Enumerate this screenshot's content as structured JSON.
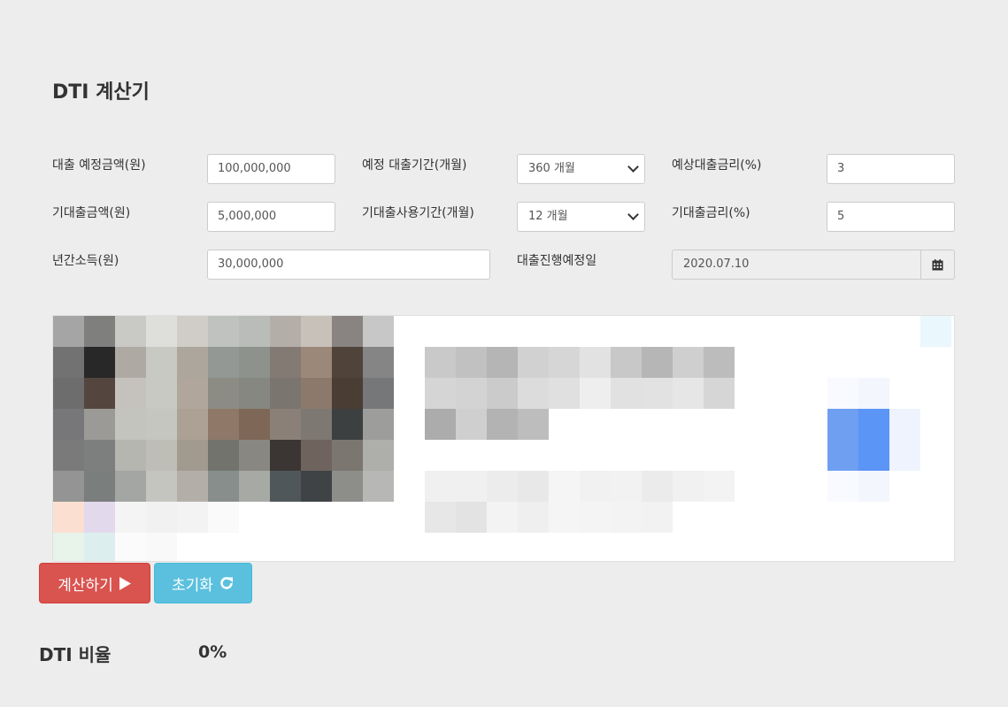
{
  "title": "DTI 계산기",
  "form": {
    "loan_amount": {
      "label": "대출 예정금액(원)",
      "value": "100,000,000"
    },
    "loan_period": {
      "label": "예정 대출기간(개월)",
      "selected": "360 개월"
    },
    "loan_rate": {
      "label": "예상대출금리(%)",
      "value": "3"
    },
    "existing_amount": {
      "label": "기대출금액(원)",
      "value": "5,000,000"
    },
    "existing_period": {
      "label": "기대출사용기간(개월)",
      "selected": "12 개월"
    },
    "existing_rate": {
      "label": "기대출금리(%)",
      "value": "5"
    },
    "annual_income": {
      "label": "년간소득(원)",
      "value": "30,000,000"
    },
    "loan_date": {
      "label": "대출진행예정일",
      "value": "2020.07.10"
    }
  },
  "buttons": {
    "calculate": {
      "label": "계산하기",
      "icon": "play-icon"
    },
    "reset": {
      "label": "초기화",
      "icon": "refresh-icon"
    }
  },
  "result": {
    "label": "DTI 비율",
    "value": "0%"
  }
}
